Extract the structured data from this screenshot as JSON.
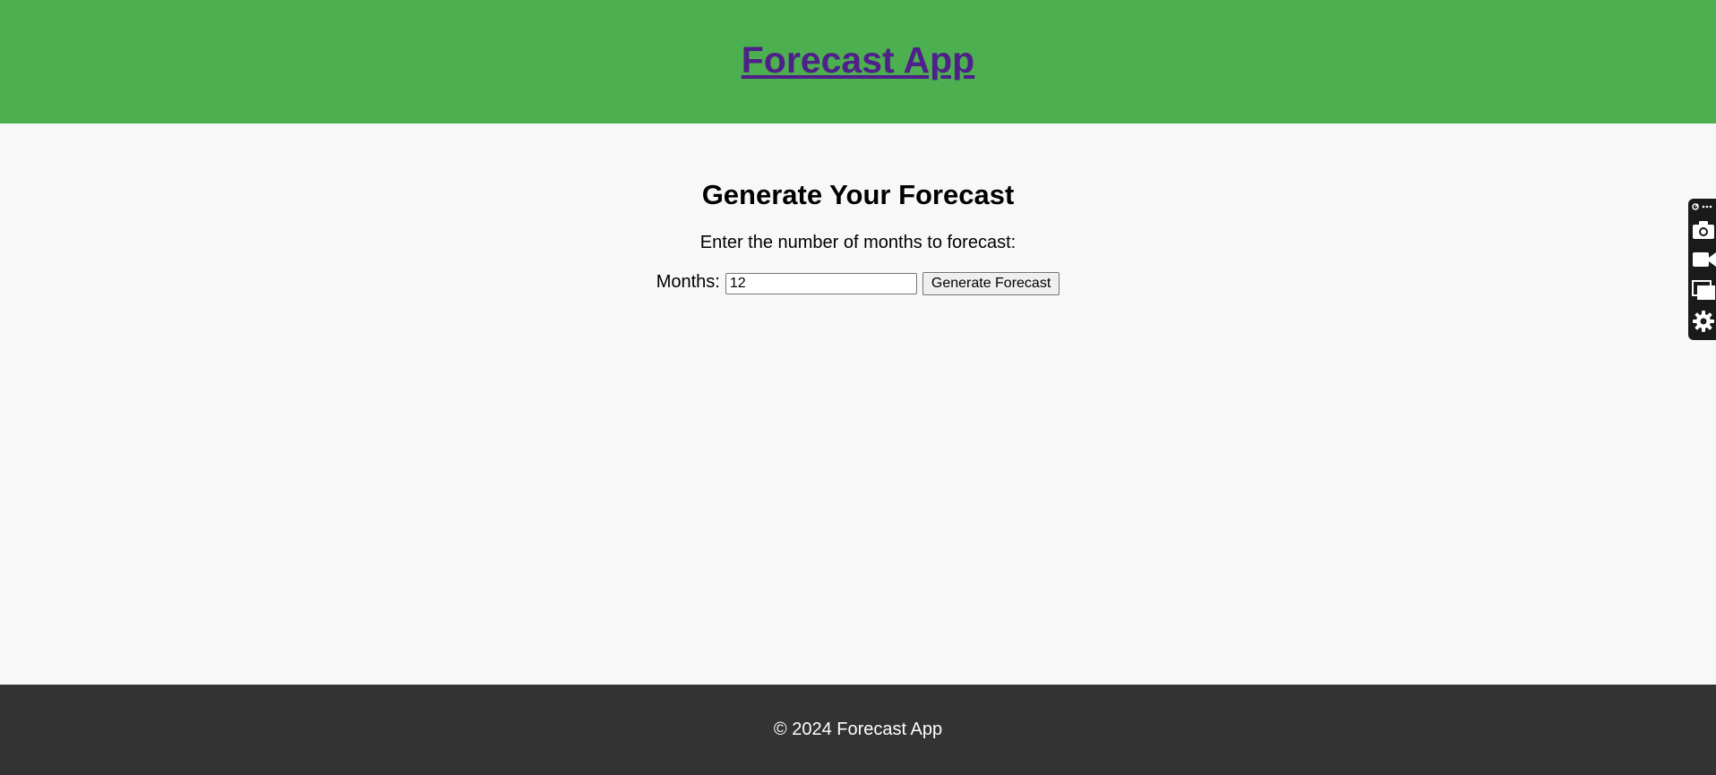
{
  "header": {
    "title": "Forecast App"
  },
  "main": {
    "heading": "Generate Your Forecast",
    "instruction": "Enter the number of months to forecast:",
    "form": {
      "months_label": "Months:",
      "months_value": "12",
      "submit_label": "Generate Forecast"
    }
  },
  "footer": {
    "copyright": "© 2024 Forecast App"
  },
  "side_toolbar": {
    "icons": [
      "extension-menu-icon",
      "camera-icon",
      "video-camera-icon",
      "windows-icon",
      "gear-icon"
    ]
  },
  "colors": {
    "header_bg": "#4caf50",
    "title_link": "#4f1f8a",
    "page_bg": "#f8f8f8",
    "footer_bg": "#333333"
  }
}
